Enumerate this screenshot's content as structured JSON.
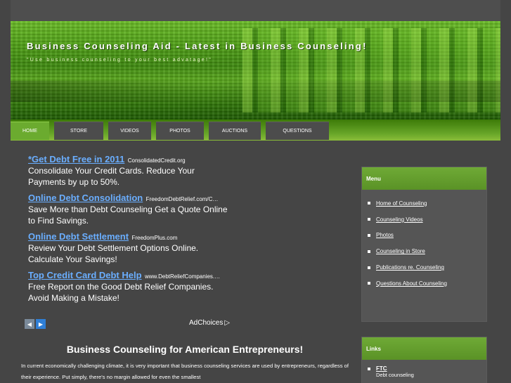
{
  "header": {
    "title": "Business Counseling Aid - Latest in Business Counseling!",
    "tagline": "\"Use business counseling to your best advatage!\""
  },
  "nav": {
    "tabs": [
      {
        "label": "HOME",
        "active": true
      },
      {
        "label": "STORE",
        "active": false
      },
      {
        "label": "VIDEOS",
        "active": false
      },
      {
        "label": "PHOTOS",
        "active": false
      },
      {
        "label": "AUCTIONS",
        "active": false
      },
      {
        "label": "QUESTIONS",
        "active": false
      }
    ]
  },
  "ads": [
    {
      "title": "*Get Debt Free in 2011",
      "url": "ConsolidatedCredit.org",
      "desc": "Consolidate Your Credit Cards. Reduce Your Payments by up to 50%."
    },
    {
      "title": "Online Debt Consolidation",
      "url": "FreedomDebtRelief.com/C…",
      "desc": "Save More than Debt Counseling Get a Quote Online to Find Savings."
    },
    {
      "title": "Online Debt Settlement",
      "url": "FreedomPlus.com",
      "desc": "Review Your Debt Settlement Options Online. Calculate Your Savings!"
    },
    {
      "title": "Top Credit Card Debt Help",
      "url": "www.DebtReliefCompanies.…",
      "desc": "Free Report on the Good Debt Relief Companies. Avoid Making a Mistake!"
    }
  ],
  "ad_controls": {
    "adchoices_label": "AdChoices"
  },
  "article": {
    "title": "Business Counseling for American Entrepreneurs!",
    "body": "In current economically challenging climate, it is very important that business counseling services are used by entrepreneurs, regardless of their experience. Put simply, there's no margin allowed for even the smallest"
  },
  "sidebar": {
    "menu": {
      "title": "Menu",
      "items": [
        "Home of Counseling",
        "Counseling Videos",
        "Photos",
        "Counseling in Store",
        "Publications re. Counseling",
        "Questions About Counseling"
      ]
    },
    "links": {
      "title": "Links",
      "items": [
        {
          "label": "FTC",
          "sub": "Debt counseling"
        }
      ]
    }
  },
  "colors": {
    "accent_green": "#6bab2f",
    "ad_link_blue": "#6aaeff",
    "background": "#454545"
  }
}
